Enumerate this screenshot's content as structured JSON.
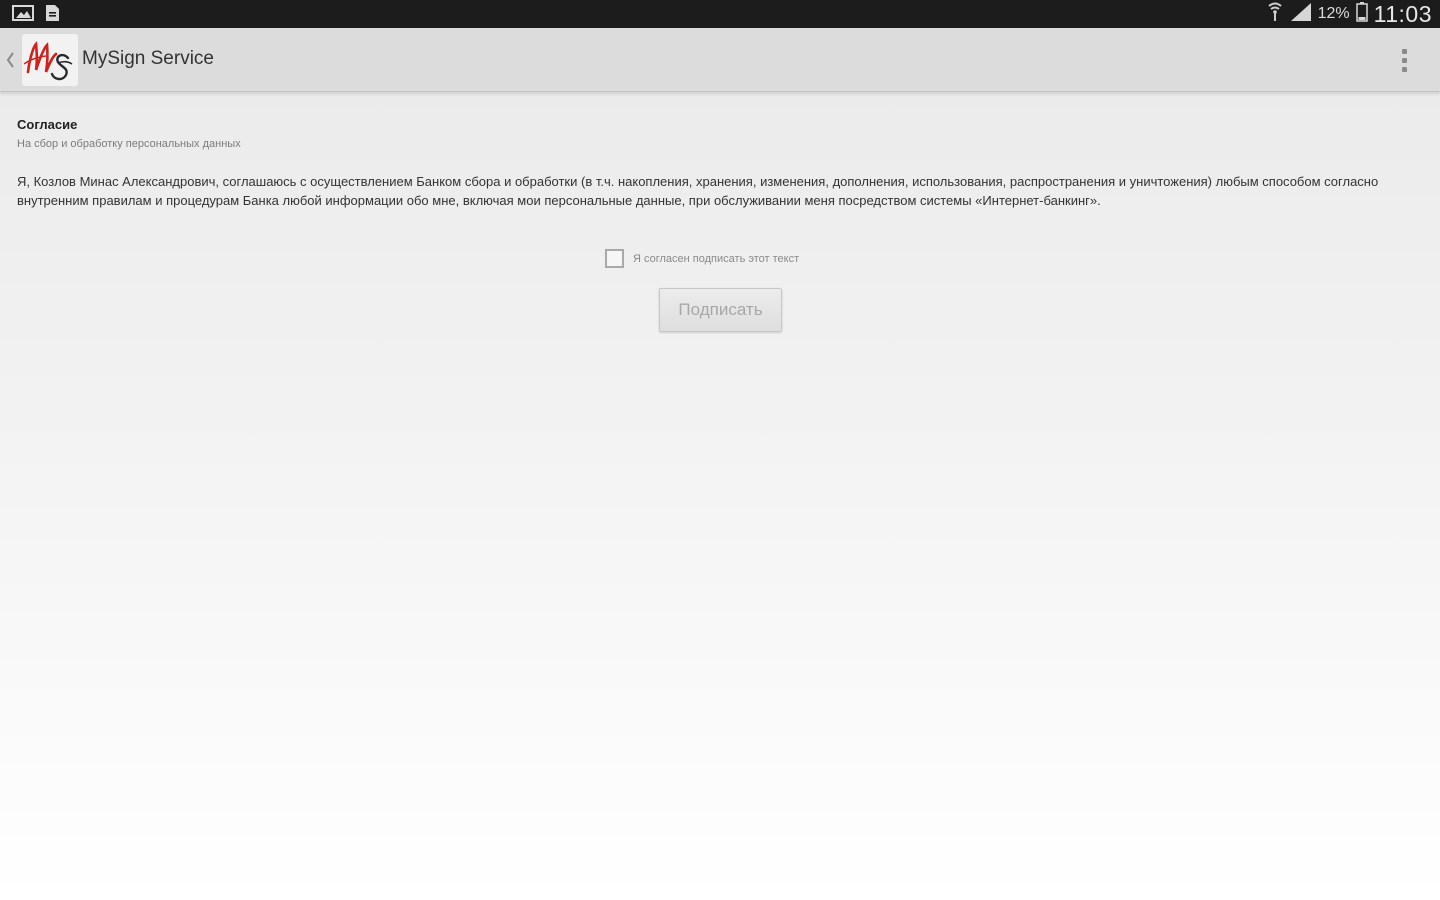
{
  "status_bar": {
    "time": "11:03",
    "battery_percent": "12%",
    "left_icons": [
      "gallery-icon",
      "document-icon"
    ],
    "right_icons": [
      "wifi-icon",
      "signal-icon",
      "battery-icon"
    ]
  },
  "action_bar": {
    "back_icon": "chevron-left-icon",
    "logo_icon": "mysign-logo",
    "title": "MySign Service",
    "overflow_icon": "overflow-menu-icon"
  },
  "consent": {
    "title": "Согласие",
    "subtitle": "На сбор и обработку персональных данных",
    "body": "Я, Козлов Минас Александрович, соглашаюсь с осуществлением Банком сбора и обработки (в т.ч. накопления, хранения, изменения, дополнения, использования, распространения и уничтожения) любым способом согласно внутренним правилам и процедурам Банка любой информации обо мне, включая мои персональные данные, при обслуживании меня посредством системы «Интернет-банкинг».",
    "checkbox_label": "Я согласен подписать этот текст",
    "checkbox_checked": false,
    "sign_button": "Подписать",
    "sign_enabled": false
  },
  "colors": {
    "status_bar_bg": "#1c1c1c",
    "action_bar_bg": "#dcdcdc",
    "logo_red": "#d0211c"
  }
}
